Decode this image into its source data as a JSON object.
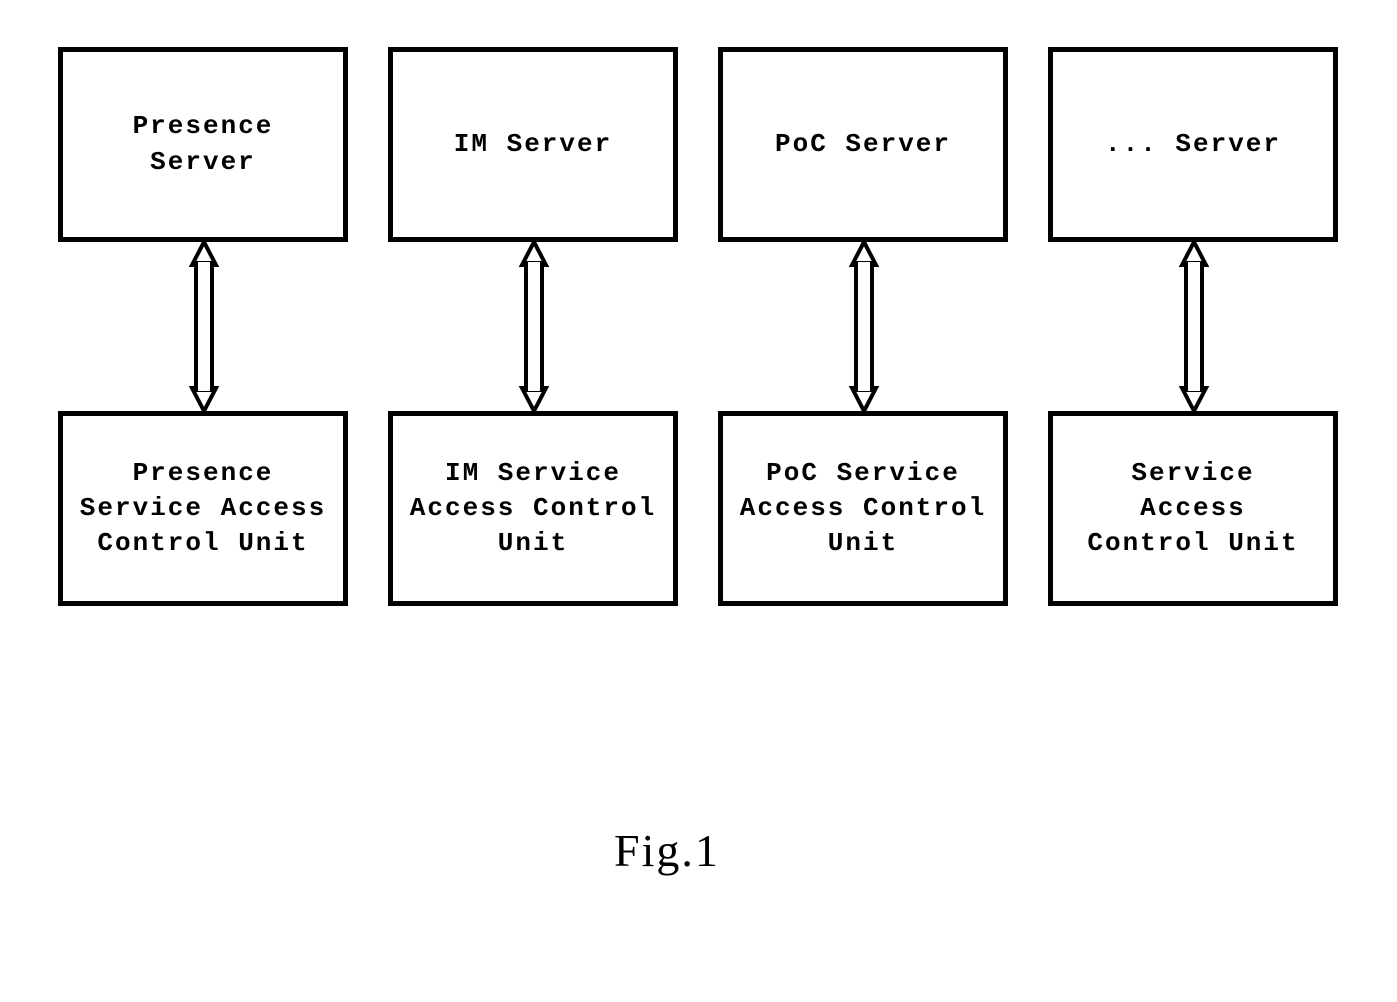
{
  "columns": [
    {
      "top_label": "Presence\nServer",
      "bottom_label": "Presence\nService Access\nControl Unit"
    },
    {
      "top_label": "IM Server",
      "bottom_label": "IM Service\nAccess Control\nUnit"
    },
    {
      "top_label": "PoC Server",
      "bottom_label": "PoC Service\nAccess Control\nUnit"
    },
    {
      "top_label": "... Server",
      "bottom_label": "Service\nAccess\nControl Unit"
    }
  ],
  "figure_label": "Fig.1"
}
